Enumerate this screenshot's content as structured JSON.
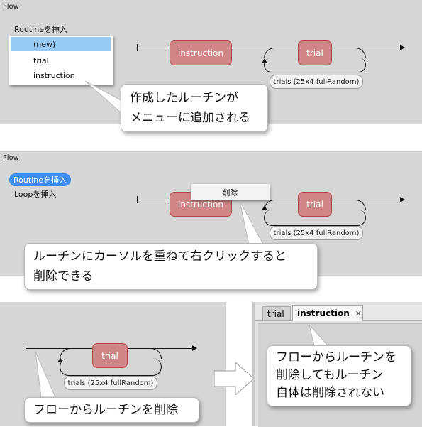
{
  "panel1": {
    "title": "Flow",
    "insert_label": "Routineを挿入",
    "menu_items": [
      "(new)",
      "trial",
      "instruction"
    ],
    "routine_instruction": "instruction",
    "routine_trial": "trial",
    "loop_label": "trials (25x4 fullRandom)",
    "callout": [
      "作成したルーチンが",
      "メニューに追加される"
    ]
  },
  "panel2": {
    "title": "Flow",
    "insert_routine": "Routineを挿入",
    "insert_loop": "Loopを挿入",
    "context_delete": "削除",
    "routine_instruction": "instruction",
    "routine_trial": "trial",
    "loop_label": "trials (25x4 fullRandom)",
    "callout": [
      "ルーチンにカーソルを重ねて右クリックすると",
      "削除できる"
    ]
  },
  "panel3": {
    "routine_trial": "trial",
    "loop_label": "trials (25x4 fullRandom)",
    "callout": "フローからルーチンを削除"
  },
  "panel4": {
    "tabs": [
      "trial",
      "instruction"
    ],
    "close_glyph": "✕",
    "callout": [
      "フローからルーチンを",
      "削除してもルーチン",
      "自体は削除されない"
    ]
  }
}
